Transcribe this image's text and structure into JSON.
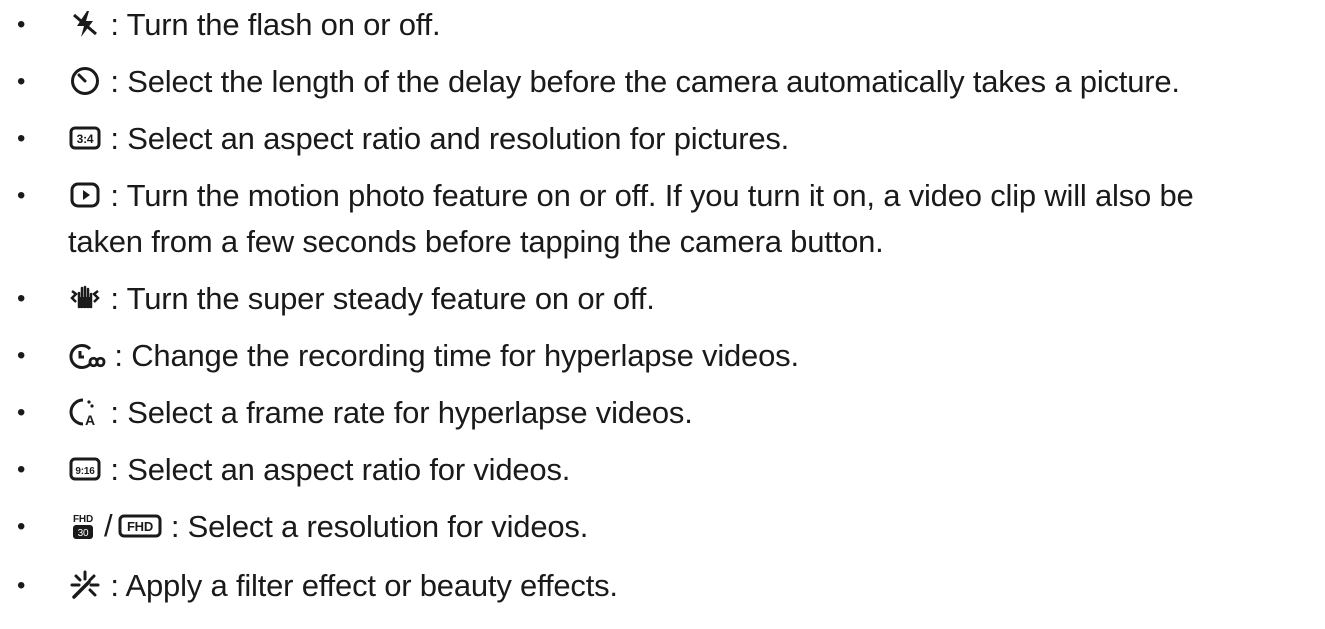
{
  "items": [
    {
      "icon": "flash-off-icon",
      "text": " : Turn the flash on or off."
    },
    {
      "icon": "timer-icon",
      "text": " : Select the length of the delay before the camera automatically takes a picture."
    },
    {
      "icon": "aspect-ratio-3-4-icon",
      "icon_text": "3:4",
      "text": " : Select an aspect ratio and resolution for pictures."
    },
    {
      "icon": "motion-photo-icon",
      "text": " : Turn the motion photo feature on or off. If you turn it on, a video clip will also be",
      "text2": "taken from a few seconds before tapping the camera button."
    },
    {
      "icon": "super-steady-icon",
      "text": " : Turn the super steady feature on or off."
    },
    {
      "icon": "hyperlapse-time-icon",
      "text": " : Change the recording time for hyperlapse videos."
    },
    {
      "icon": "frame-rate-icon",
      "icon_text": "A",
      "text": " : Select a frame rate for hyperlapse videos."
    },
    {
      "icon": "aspect-ratio-9-16-icon",
      "icon_text": "9:16",
      "text": " : Select an aspect ratio for videos."
    },
    {
      "icon": "resolution-icon",
      "icon_text_a": "FHD",
      "icon_text_b": "30",
      "separator": "/",
      "icon_text_c": "FHD",
      "text": " : Select a resolution for videos."
    },
    {
      "icon": "filter-icon",
      "text": " : Apply a filter effect or beauty effects."
    }
  ],
  "bullet": "•"
}
